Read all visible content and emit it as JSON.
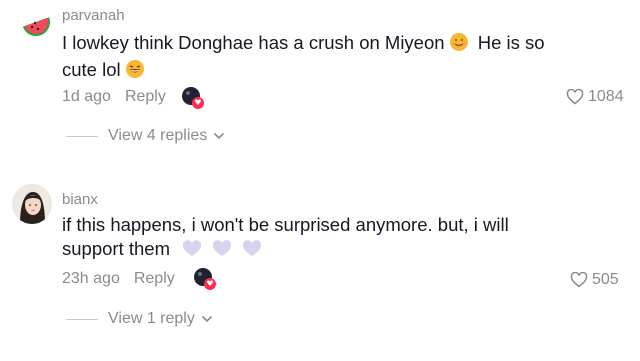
{
  "comments": [
    {
      "username": "parvanah",
      "text_part1": "I lowkey think Donghae has a crush on Miyeon",
      "text_part2": "He is so",
      "text_part3": "cute lol",
      "time": "1d ago",
      "reply_label": "Reply",
      "likes": "1084",
      "view_replies": "View 4 replies"
    },
    {
      "username": "bianx",
      "text_part1": "if this happens, i won't be surprised anymore. but, i will",
      "text_part2": "support them",
      "time": "23h ago",
      "reply_label": "Reply",
      "likes": "505",
      "view_replies": "View 1 reply"
    }
  ],
  "colors": {
    "text": "#161823",
    "muted": "#8a8b91",
    "accent": "#fe2c55"
  },
  "icons": [
    "watermelon-avatar",
    "smiling-face-icon",
    "laughing-face-icon",
    "heart-outline-icon",
    "chevron-down-icon",
    "react-sticker-icon",
    "lavender-heart-icon"
  ]
}
